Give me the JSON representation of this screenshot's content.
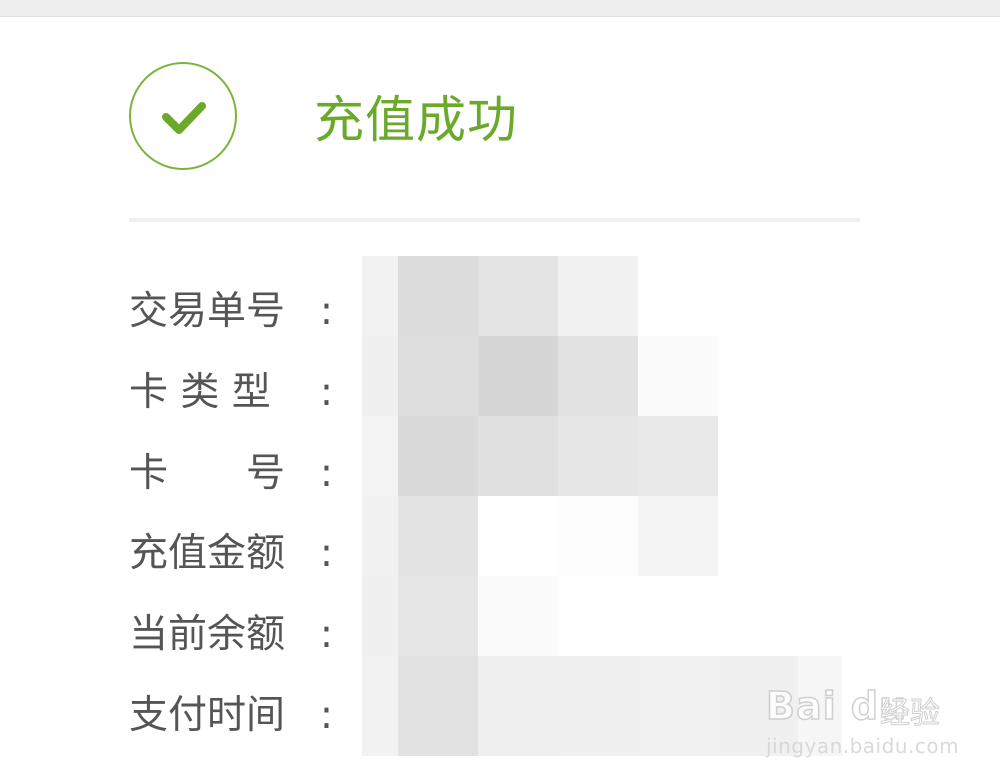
{
  "header": {
    "title": "充值成功",
    "status_icon": "check-circle-icon",
    "accent_color": "#6aa92a"
  },
  "details": {
    "rows": [
      {
        "label": "交易单号",
        "value_state": "pixelated"
      },
      {
        "label": "卡 类 型",
        "value_state": "pixelated"
      },
      {
        "label": "卡　　号",
        "value_state": "pixelated"
      },
      {
        "label": "充值金额",
        "value_state": "pixelated"
      },
      {
        "label": "当前余额",
        "value_state": "pixelated"
      },
      {
        "label": "支付时间",
        "value_state": "pixelated"
      }
    ],
    "colon": ":"
  },
  "watermark": {
    "logo": "Bai du",
    "suffix": "经验",
    "url": "jingyan.baidu.com"
  }
}
